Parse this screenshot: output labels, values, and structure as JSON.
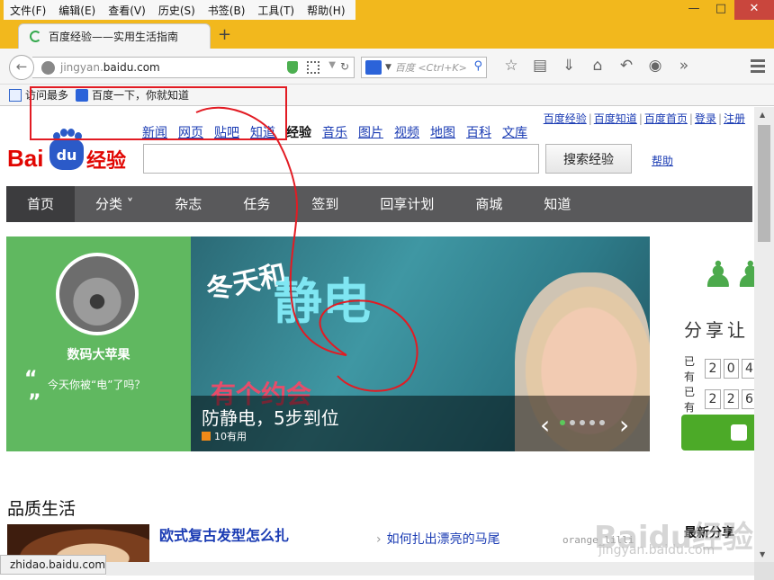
{
  "menubar": {
    "items": [
      "文件(F)",
      "编辑(E)",
      "查看(V)",
      "历史(S)",
      "书签(B)",
      "工具(T)",
      "帮助(H)"
    ],
    "window_controls": [
      "minimize-icon",
      "maximize-icon",
      "close-icon"
    ]
  },
  "tab": {
    "title": "百度经验——实用生活指南",
    "new_tab_label": "+"
  },
  "navbar": {
    "url_prefix": "jingyan.",
    "url_domain": "baidu.com",
    "search_placeholder": "百度 <Ctrl+K>",
    "icons": [
      "back-icon",
      "globe-icon",
      "shield-icon",
      "qr-icon",
      "dropdown-icon",
      "refresh-icon",
      "baidu-paw-icon",
      "search-icon",
      "star-icon",
      "reader-icon",
      "download-icon",
      "home-icon",
      "undo-icon",
      "chat-icon",
      "overflow-icon",
      "menu-icon"
    ]
  },
  "bookmarks": [
    {
      "label": "访问最多",
      "icon": "frequent-icon"
    },
    {
      "label": "百度一下，你就知道",
      "icon": "baidu-paw-icon"
    }
  ],
  "page": {
    "toplinks": [
      "百度经验",
      "百度知道",
      "百度首页",
      "登录",
      "注册"
    ],
    "logo": {
      "bai": "Bai",
      "du": "du",
      "jy": "经验"
    },
    "channels": [
      "新闻",
      "网页",
      "贴吧",
      "知道",
      "经验",
      "音乐",
      "图片",
      "视频",
      "地图",
      "百科",
      "文库"
    ],
    "current_channel_index": 4,
    "search_button": "搜索经验",
    "help": "帮助",
    "mainnav": [
      "首页",
      "分类 ˅",
      "杂志",
      "任务",
      "签到",
      "回享计划",
      "商城",
      "知道"
    ],
    "hero": {
      "user_name": "数码大苹果",
      "quote_open": "“",
      "quote_close": "”",
      "quote_text": "今天你被“电”了吗？",
      "banner_text_1": "冬天和",
      "banner_text_2": "静电",
      "banner_text_3": "有个约会",
      "caption_title": "防静电，5步到位",
      "caption_likes": "10有用",
      "prev_arrow": "‹",
      "next_arrow": "›",
      "slides": 5,
      "active_slide": 1
    },
    "right": {
      "icon": "people-icon",
      "share_text": "分享让",
      "row1_label": "已有",
      "row1_digits": [
        "2",
        "0",
        "4"
      ],
      "row2_label": "已有",
      "row2_digits": [
        "2",
        "2",
        "6"
      ]
    },
    "section_title": "品质生活",
    "article_main": "欧式复古发型怎么扎",
    "article_side": "如何扎出漂亮的马尾",
    "article_tag": "orange_lilli",
    "latest_label": "最新分享"
  },
  "statusbar": {
    "text": "zhidao.baidu.com"
  },
  "watermark": {
    "line1": "Baidu经验",
    "line2": "jingyan.baidu.com"
  },
  "annotation_colors": {
    "stroke": "#e21b23"
  }
}
